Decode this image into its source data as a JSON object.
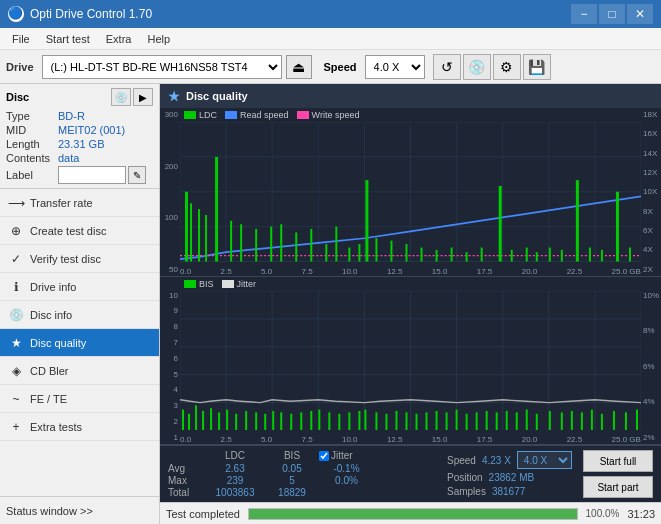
{
  "titlebar": {
    "title": "Opti Drive Control 1.70",
    "minimize": "−",
    "maximize": "□",
    "close": "✕"
  },
  "menubar": {
    "items": [
      "File",
      "Start test",
      "Extra",
      "Help"
    ]
  },
  "drive_toolbar": {
    "drive_label": "Drive",
    "drive_value": "(L:) HL-DT-ST BD-RE  WH16NS58 TST4",
    "speed_label": "Speed",
    "speed_value": "4.0 X"
  },
  "disc_section": {
    "label": "Disc",
    "type_label": "Type",
    "type_value": "BD-R",
    "mid_label": "MID",
    "mid_value": "MEIT02 (001)",
    "length_label": "Length",
    "length_value": "23.31 GB",
    "contents_label": "Contents",
    "contents_value": "data",
    "label_label": "Label",
    "label_value": ""
  },
  "nav_items": [
    {
      "id": "transfer-rate",
      "label": "Transfer rate",
      "icon": "⟶"
    },
    {
      "id": "create-test-disc",
      "label": "Create test disc",
      "icon": "⊕"
    },
    {
      "id": "verify-test-disc",
      "label": "Verify test disc",
      "icon": "✓"
    },
    {
      "id": "drive-info",
      "label": "Drive info",
      "icon": "ℹ"
    },
    {
      "id": "disc-info",
      "label": "Disc info",
      "icon": "💿"
    },
    {
      "id": "disc-quality",
      "label": "Disc quality",
      "icon": "★",
      "active": true
    },
    {
      "id": "cd-bler",
      "label": "CD Bler",
      "icon": "◈"
    },
    {
      "id": "fe-te",
      "label": "FE / TE",
      "icon": "~"
    },
    {
      "id": "extra-tests",
      "label": "Extra tests",
      "icon": "+"
    }
  ],
  "quality_panel": {
    "title": "Disc quality",
    "legend1_label": "LDC",
    "legend2_label": "Read speed",
    "legend3_label": "Write speed",
    "legend4_label": "BIS",
    "legend5_label": "Jitter",
    "legend1_color": "#00cc00",
    "legend2_color": "#4488ff",
    "legend3_color": "#ff44aa",
    "legend4_color": "#00cc00",
    "legend5_color": "#dddddd"
  },
  "stats": {
    "ldc_label": "LDC",
    "bis_label": "BIS",
    "jitter_label": "Jitter",
    "speed_label": "Speed",
    "speed_value": "4.23 X",
    "speed_select": "4.0 X",
    "position_label": "Position",
    "position_value": "23862 MB",
    "samples_label": "Samples",
    "samples_value": "381677",
    "avg_label": "Avg",
    "avg_ldc": "2.63",
    "avg_bis": "0.05",
    "avg_jitter": "-0.1%",
    "max_label": "Max",
    "max_ldc": "239",
    "max_bis": "5",
    "max_jitter": "0.0%",
    "total_label": "Total",
    "total_ldc": "1003863",
    "total_bis": "18829",
    "total_jitter": "",
    "start_full_label": "Start full",
    "start_part_label": "Start part"
  },
  "bottom_status": {
    "status_text": "Test completed",
    "progress_percent": 100,
    "time_label": "31:23"
  },
  "status_window_label": "Status window >>",
  "chart1": {
    "y_labels": [
      "300",
      "200",
      "100",
      "50"
    ],
    "y_labels_right": [
      "18X",
      "16X",
      "14X",
      "12X",
      "10X",
      "8X",
      "6X",
      "4X",
      "2X"
    ],
    "x_labels": [
      "0.0",
      "2.5",
      "5.0",
      "7.5",
      "10.0",
      "12.5",
      "15.0",
      "17.5",
      "20.0",
      "22.5",
      "25.0 GB"
    ]
  },
  "chart2": {
    "y_labels": [
      "10",
      "9",
      "8",
      "7",
      "6",
      "5",
      "4",
      "3",
      "2",
      "1"
    ],
    "y_labels_right": [
      "10%",
      "8%",
      "6%",
      "4%",
      "2%"
    ],
    "x_labels": [
      "0.0",
      "2.5",
      "5.0",
      "7.5",
      "10.0",
      "12.5",
      "15.0",
      "17.5",
      "20.0",
      "22.5",
      "25.0 GB"
    ]
  }
}
